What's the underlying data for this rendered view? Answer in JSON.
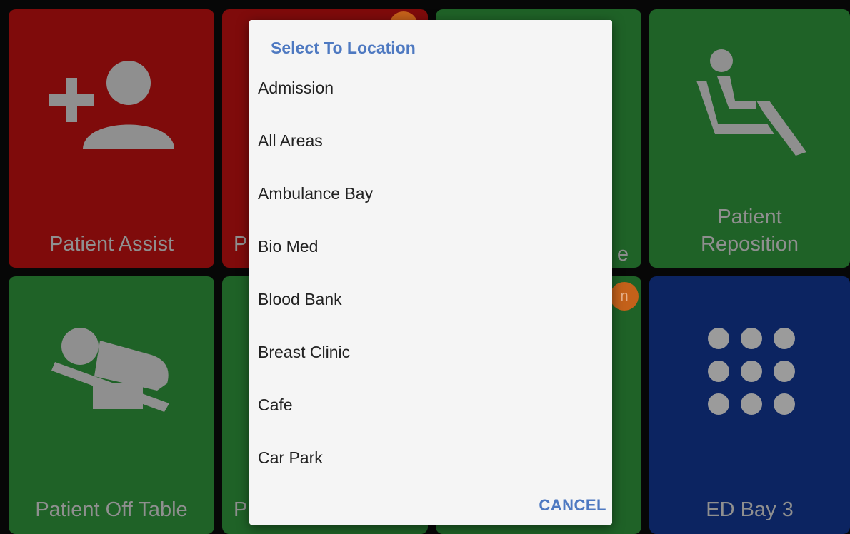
{
  "tiles": [
    {
      "label": "Patient Assist"
    },
    {
      "label": "P"
    },
    {
      "label": "e"
    },
    {
      "label": "Patient Reposition"
    },
    {
      "label": "Patient Off Table"
    },
    {
      "label": "P"
    },
    {
      "label": ""
    },
    {
      "label": "ED Bay 3"
    }
  ],
  "badges": [
    "",
    "n"
  ],
  "dialog": {
    "title": "Select To Location",
    "items": [
      {
        "label": "Admission"
      },
      {
        "label": "All Areas"
      },
      {
        "label": "Ambulance Bay"
      },
      {
        "label": "Bio Med"
      },
      {
        "label": "Blood Bank"
      },
      {
        "label": "Breast Clinic"
      },
      {
        "label": "Cafe"
      },
      {
        "label": "Car Park"
      }
    ],
    "cancel_label": "CANCEL"
  },
  "colors": {
    "tile_red": "#7f0b0b",
    "tile_green": "#1f6227",
    "tile_navy": "#0c2461",
    "badge": "#c4611a",
    "accent": "#4e79c1"
  },
  "icons": [
    "add-person-icon",
    "seated-patient-icon",
    "patient-on-table-icon",
    "grid-dots-icon"
  ]
}
